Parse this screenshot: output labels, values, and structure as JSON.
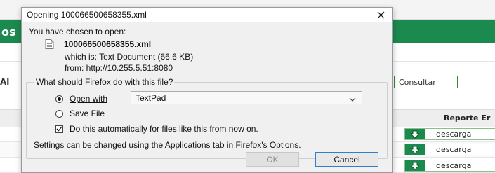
{
  "background": {
    "header_text": "os",
    "side_label": "Al",
    "consultar_label": "Consultar",
    "table_header": "Reporte Er",
    "download_rows": [
      "descarga",
      "descarga",
      "descarga"
    ],
    "accent_green": "#1b8a4e"
  },
  "dialog": {
    "title": "Opening 100066500658355.xml",
    "intro": "You have chosen to open:",
    "filename": "100066500658355.xml",
    "which_is": "which is:  Text Document (66,6 KB)",
    "from": "from:  http://10.255.5.51:8080",
    "group_label": "What should Firefox do with this file?",
    "open_with_label": "Open with",
    "open_with_app": "TextPad",
    "save_file_label": "Save File",
    "auto_label": "Do this automatically for files like this from now on.",
    "settings_note": "Settings can be changed using the Applications tab in Firefox's Options.",
    "ok_label": "OK",
    "cancel_label": "Cancel",
    "selected_option": "open_with",
    "auto_checked": true
  }
}
